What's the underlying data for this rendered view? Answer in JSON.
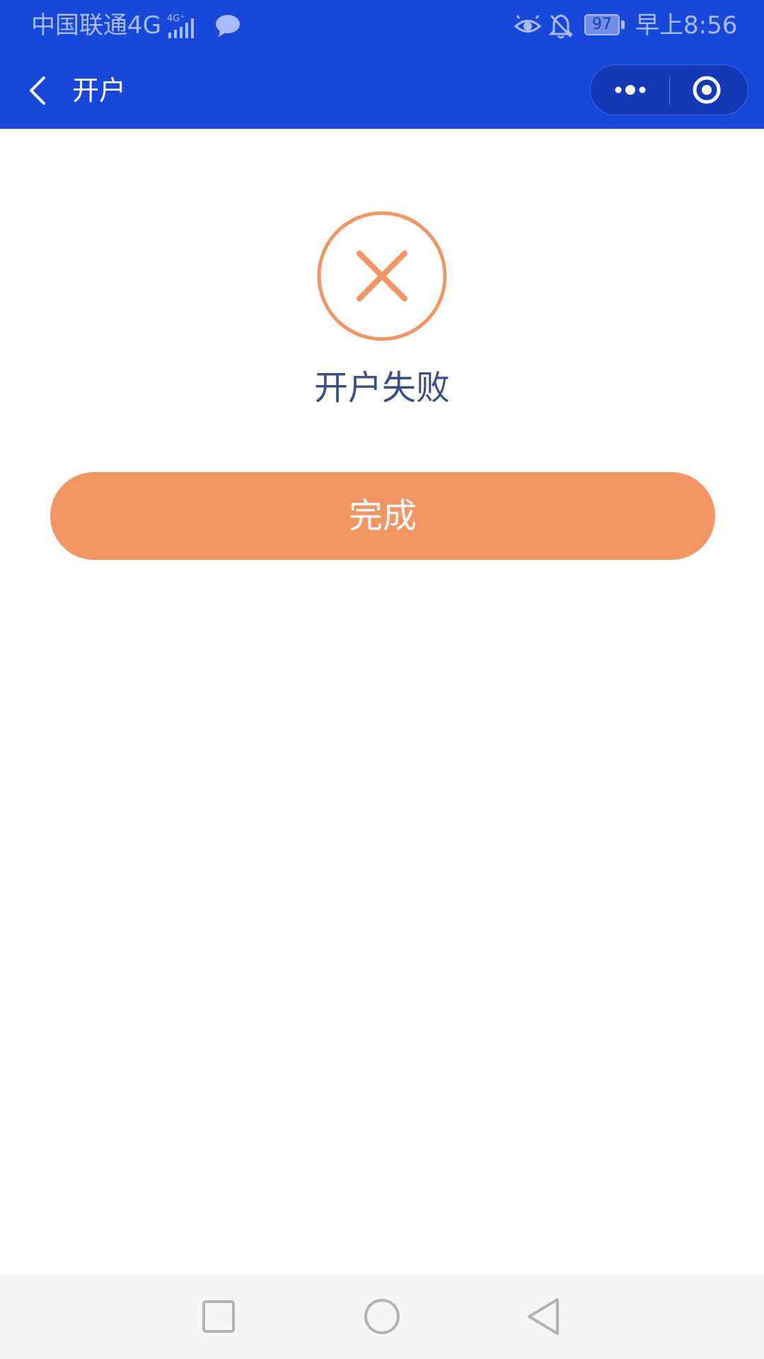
{
  "status_bar": {
    "carrier": "中国联通4G",
    "network_badge": "4G⁺",
    "battery_level": "97",
    "time": "早上8:56",
    "icons": [
      "signal-icon",
      "chat-notification-icon",
      "eye-icon",
      "mute-bell-icon",
      "battery-icon"
    ]
  },
  "nav": {
    "title": "开户",
    "icons": [
      "back-chevron-icon",
      "more-dots-icon",
      "close-target-icon"
    ]
  },
  "result": {
    "icon": "failure-x-icon",
    "message": "开户失败"
  },
  "actions": {
    "done_label": "完成"
  },
  "system_nav": {
    "icons": [
      "recents-square-icon",
      "home-circle-icon",
      "back-triangle-icon"
    ]
  },
  "colors": {
    "header_blue": "#1848d9",
    "accent_orange": "#f29563",
    "result_text": "#3b4f86",
    "system_nav_bg": "#f5f5f5"
  }
}
